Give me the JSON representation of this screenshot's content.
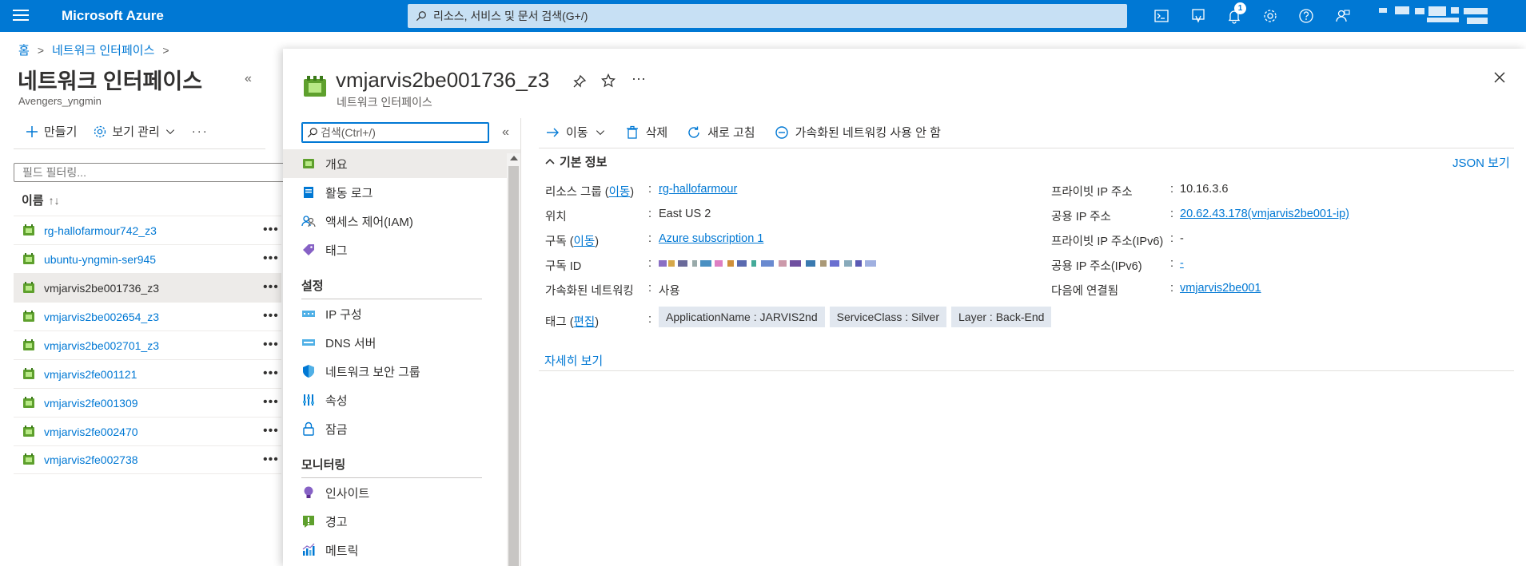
{
  "topbar": {
    "brand": "Microsoft Azure",
    "search_placeholder": "리소스, 서비스 및 문서 검색(G+/)",
    "notification_count": "1",
    "icons": [
      "cloud-shell-icon",
      "directory-filter-icon",
      "notifications-icon",
      "settings-icon",
      "help-icon",
      "feedback-icon"
    ]
  },
  "breadcrumb": {
    "home": "홈",
    "current": "네트워크 인터페이스"
  },
  "left": {
    "title": "네트워크 인터페이스",
    "subtitle": "Avengers_yngmin",
    "create_label": "만들기",
    "view_label": "보기 관리",
    "filter_placeholder": "필드 필터링...",
    "col_name": "이름",
    "items": [
      {
        "name": "rg-hallofarmour742_z3"
      },
      {
        "name": "ubuntu-yngmin-ser945"
      },
      {
        "name": "vmjarvis2be001736_z3"
      },
      {
        "name": "vmjarvis2be002654_z3"
      },
      {
        "name": "vmjarvis2be002701_z3"
      },
      {
        "name": "vmjarvis2fe001121"
      },
      {
        "name": "vmjarvis2fe001309"
      },
      {
        "name": "vmjarvis2fe002470"
      },
      {
        "name": "vmjarvis2fe002738"
      }
    ]
  },
  "blade": {
    "title": "vmjarvis2be001736_z3",
    "subtitle": "네트워크 인터페이스",
    "menu_search_placeholder": "검색(Ctrl+/)",
    "menu": {
      "overview": "개요",
      "activity_log": "활동 로그",
      "iam": "액세스 제어(IAM)",
      "tags": "태그",
      "section_settings": "설정",
      "ip_config": "IP 구성",
      "dns": "DNS 서버",
      "nsg": "네트워크 보안 그룹",
      "properties": "속성",
      "locks": "잠금",
      "section_monitoring": "모니터링",
      "insights": "인사이트",
      "alerts": "경고",
      "metrics": "메트릭"
    },
    "commands": {
      "move": "이동",
      "delete": "삭제",
      "refresh": "새로 고침",
      "disable_accel": "가속화된 네트워킹 사용 안 함"
    },
    "essentials": {
      "title": "기본 정보",
      "json_view": "JSON 보기",
      "resource_group_label": "리소스 그룹",
      "move_link": "이동",
      "resource_group": "rg-hallofarmour",
      "location_label": "위치",
      "location": "East US 2",
      "subscription_label": "구독",
      "subscription": "Azure subscription 1",
      "subscription_id_label": "구독 ID",
      "accel_label": "가속화된 네트워킹",
      "accel": "사용",
      "private_ip_label": "프라이빗 IP 주소",
      "private_ip": "10.16.3.6",
      "public_ip_label": "공용 IP 주소",
      "public_ip": "20.62.43.178(vmjarvis2be001-ip)",
      "private_ipv6_label": "프라이빗 IP 주소(IPv6)",
      "private_ipv6": "-",
      "public_ipv6_label": "공용 IP 주소(IPv6)",
      "public_ipv6": "-",
      "connected_label": "다음에 연결됨",
      "connected": "vmjarvis2be001",
      "tags_label": "태그",
      "edit_link": "편집",
      "tags": [
        "ApplicationName : JARVIS2nd",
        "ServiceClass : Silver",
        "Layer : Back-End"
      ],
      "more": "자세히 보기"
    }
  },
  "colors": {
    "accent": "#0078d4",
    "search_bg": "#c7e0f4",
    "selected_bg": "#edebe9",
    "tag_bg": "#e1e7ef"
  }
}
